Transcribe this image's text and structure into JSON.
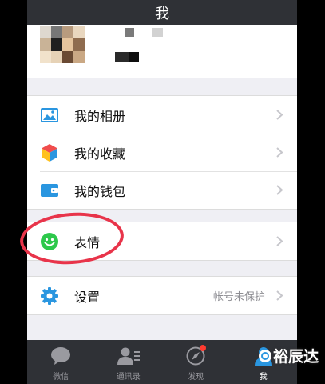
{
  "nav_bar": {
    "title": "我"
  },
  "menu": {
    "album": {
      "label": "我的相册",
      "icon": "photo-album-icon"
    },
    "favorites": {
      "label": "我的收藏",
      "icon": "favorites-cube-icon"
    },
    "wallet": {
      "label": "我的钱包",
      "icon": "wallet-icon"
    },
    "stickers": {
      "label": "表情",
      "icon": "smiley-icon"
    },
    "settings": {
      "label": "设置",
      "icon": "gear-icon",
      "detail": "帐号未保护"
    }
  },
  "tab_bar": {
    "items": [
      {
        "label": "微信",
        "icon": "chat-bubble-icon",
        "active": false
      },
      {
        "label": "通讯录",
        "icon": "contacts-icon",
        "active": false
      },
      {
        "label": "发现",
        "icon": "compass-icon",
        "active": false,
        "badge": true
      },
      {
        "label": "我",
        "icon": "person-icon",
        "active": true
      }
    ]
  },
  "watermark": {
    "text": "裕辰达"
  },
  "colors": {
    "nav_background": "#2f3136",
    "accent_blue": "#2a96e0",
    "smiley_green": "#2dc84b",
    "annotation_red": "#e8344a",
    "badge_red": "#ff3b30"
  }
}
